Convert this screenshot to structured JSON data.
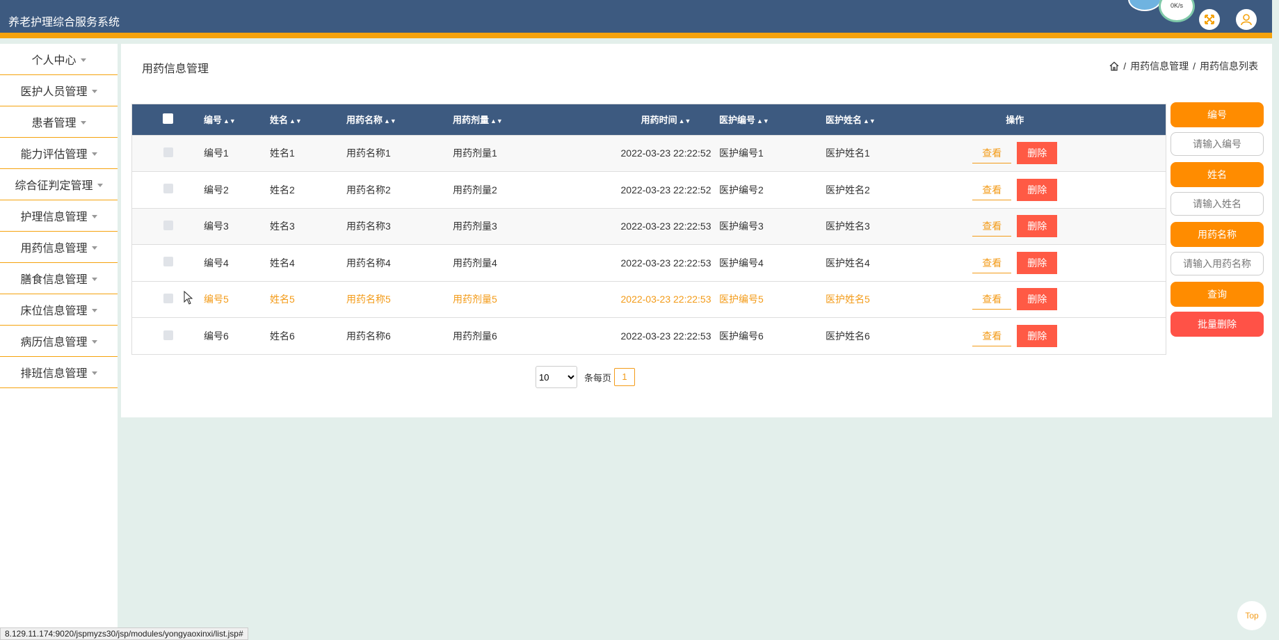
{
  "app": {
    "title": "养老护理综合服务系统"
  },
  "header": {
    "net_speed": "0K/s",
    "fullscreen_icon": "expand-icon",
    "user_icon": "user-icon",
    "accent_color": "#3d5a80",
    "bar_color": "#f5a20c"
  },
  "sidebar": {
    "items": [
      {
        "label": "个人中心"
      },
      {
        "label": "医护人员管理"
      },
      {
        "label": "患者管理"
      },
      {
        "label": "能力评估管理"
      },
      {
        "label": "综合征判定管理"
      },
      {
        "label": "护理信息管理"
      },
      {
        "label": "用药信息管理"
      },
      {
        "label": "膳食信息管理"
      },
      {
        "label": "床位信息管理"
      },
      {
        "label": "病历信息管理"
      },
      {
        "label": "排班信息管理"
      }
    ]
  },
  "page": {
    "title": "用药信息管理",
    "breadcrumb": [
      "用药信息管理",
      "用药信息列表"
    ],
    "breadcrumb_sep": "/"
  },
  "table": {
    "columns": [
      "编号",
      "姓名",
      "用药名称",
      "用药剂量",
      "用药时间",
      "医护编号",
      "医护姓名",
      "操作"
    ],
    "rows": [
      {
        "c1": "编号1",
        "c2": "姓名1",
        "c3": "用药名称1",
        "c4": "用药剂量1",
        "c5": "2022-03-23 22:22:52",
        "c6": "医护编号1",
        "c7": "医护姓名1"
      },
      {
        "c1": "编号2",
        "c2": "姓名2",
        "c3": "用药名称2",
        "c4": "用药剂量2",
        "c5": "2022-03-23 22:22:52",
        "c6": "医护编号2",
        "c7": "医护姓名2"
      },
      {
        "c1": "编号3",
        "c2": "姓名3",
        "c3": "用药名称3",
        "c4": "用药剂量3",
        "c5": "2022-03-23 22:22:53",
        "c6": "医护编号3",
        "c7": "医护姓名3"
      },
      {
        "c1": "编号4",
        "c2": "姓名4",
        "c3": "用药名称4",
        "c4": "用药剂量4",
        "c5": "2022-03-23 22:22:53",
        "c6": "医护编号4",
        "c7": "医护姓名4"
      },
      {
        "c1": "编号5",
        "c2": "姓名5",
        "c3": "用药名称5",
        "c4": "用药剂量5",
        "c5": "2022-03-23 22:22:53",
        "c6": "医护编号5",
        "c7": "医护姓名5"
      },
      {
        "c1": "编号6",
        "c2": "姓名6",
        "c3": "用药名称6",
        "c4": "用药剂量6",
        "c5": "2022-03-23 22:22:53",
        "c6": "医护编号6",
        "c7": "医护姓名6"
      }
    ],
    "view_label": "查看",
    "delete_label": "删除",
    "highlight_color": "#f39b18"
  },
  "search": {
    "id_label": "编号",
    "id_placeholder": "请输入编号",
    "name_label": "姓名",
    "name_placeholder": "请输入姓名",
    "drug_label": "用药名称",
    "drug_placeholder": "请输入用药名称",
    "query_label": "查询",
    "batch_delete_label": "批量删除"
  },
  "pagination": {
    "page_size": "10",
    "per_page_label": "条每页",
    "current_page": "1"
  },
  "footer": {
    "top_label": "Top",
    "status_url": "8.129.11.174:9020/jspmyzs30/jsp/modules/yongyaoxinxi/list.jsp#"
  }
}
